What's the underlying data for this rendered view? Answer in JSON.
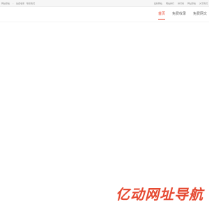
{
  "topbar": {
    "left_items": [
      "网站导航",
      "…",
      "免费收录",
      "联系我们"
    ],
    "right_items": [
      "最新网站",
      "网站排行",
      "排行榜",
      "网址导航",
      "关于我们"
    ]
  },
  "nav": {
    "items": [
      {
        "label": "首页",
        "active": true
      },
      {
        "label": "免费收录",
        "active": false
      },
      {
        "label": "免费网文",
        "active": false
      }
    ]
  },
  "brand": {
    "text": "亿动网址导航",
    "color": "#e64a32"
  }
}
